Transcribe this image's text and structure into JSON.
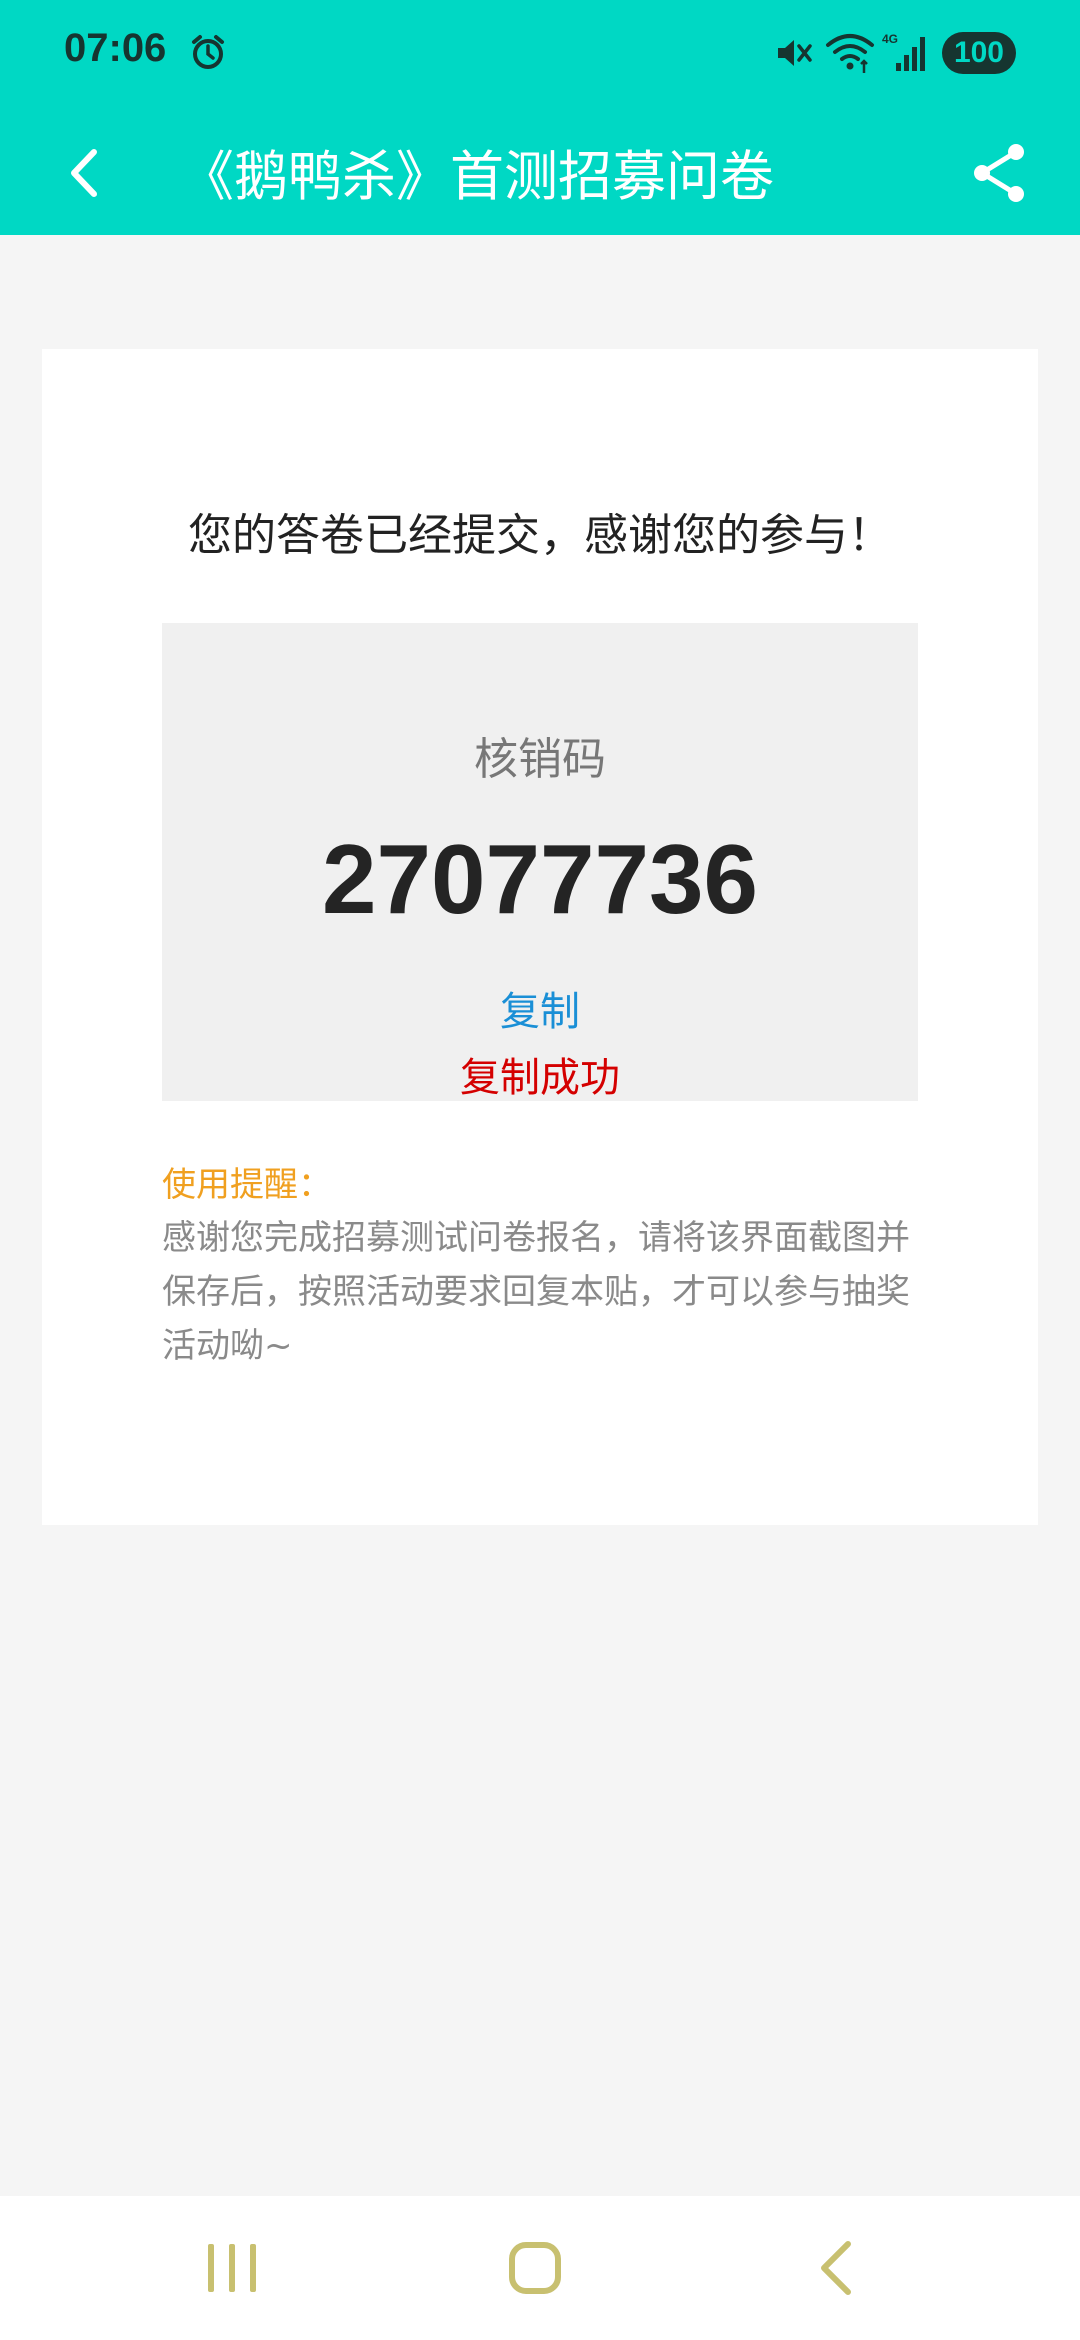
{
  "status_bar": {
    "time": "07:06",
    "battery": "100",
    "network": "4G"
  },
  "nav": {
    "title": "《鹅鸭杀》首测招募问卷"
  },
  "card": {
    "success_message": "您的答卷已经提交，感谢您的参与！",
    "code_label": "核销码",
    "code_value": "27077736",
    "copy_label": "复制",
    "copy_success": "复制成功",
    "reminder_title": "使用提醒：",
    "reminder_body": "感谢您完成招募测试问卷报名，请将该界面截图并保存后，按照活动要求回复本贴，才可以参与抽奖活动呦~"
  },
  "colors": {
    "accent": "#00d8c4",
    "link": "#1a8fd6",
    "success_red": "#d40000",
    "reminder_orange": "#f0a020",
    "system_nav_icons": "#c8c070"
  },
  "icons": {
    "status_left": [
      "alarm-icon"
    ],
    "status_right": [
      "mute-icon",
      "wifi-icon",
      "signal-icon"
    ],
    "nav": [
      "back-arrow-icon",
      "share-icon"
    ],
    "system_nav": [
      "recents-icon",
      "home-icon",
      "back-icon"
    ]
  }
}
